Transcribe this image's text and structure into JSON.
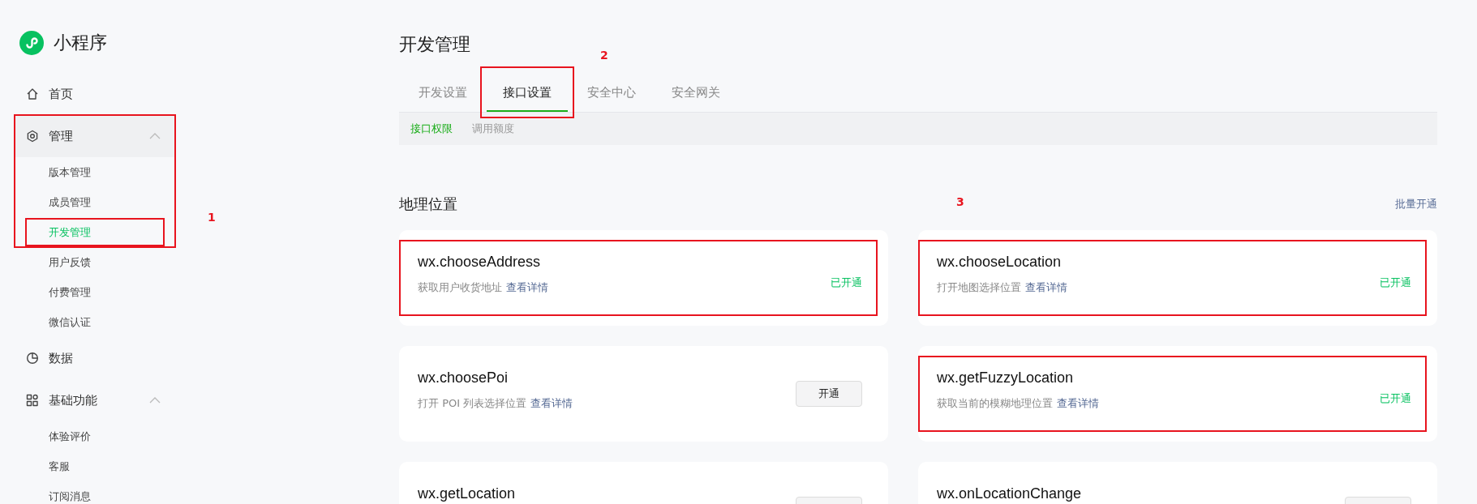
{
  "sidebar": {
    "logo": {
      "title": "小程序"
    },
    "items": [
      {
        "label": "首页"
      },
      {
        "label": "管理",
        "expanded": true,
        "marked": true,
        "marker": "1",
        "children": [
          {
            "label": "版本管理",
            "selected": false
          },
          {
            "label": "成员管理",
            "selected": false
          },
          {
            "label": "开发管理",
            "selected": true,
            "marked": true
          },
          {
            "label": "用户反馈",
            "selected": false
          },
          {
            "label": "付费管理",
            "selected": false
          },
          {
            "label": "微信认证",
            "selected": false
          }
        ]
      },
      {
        "label": "数据"
      },
      {
        "label": "基础功能",
        "expanded": true,
        "children": [
          {
            "label": "体验评价",
            "selected": false
          },
          {
            "label": "客服",
            "selected": false
          },
          {
            "label": "订阅消息",
            "selected": false
          }
        ]
      }
    ]
  },
  "page": {
    "title": "开发管理",
    "tabs": [
      {
        "label": "开发设置",
        "selected": false
      },
      {
        "label": "接口设置",
        "selected": true,
        "marked": true,
        "marker": "2"
      },
      {
        "label": "安全中心",
        "selected": false
      },
      {
        "label": "安全网关",
        "selected": false
      }
    ],
    "subtabs": [
      {
        "label": "接口权限",
        "selected": true
      },
      {
        "label": "调用额度",
        "selected": false
      }
    ]
  },
  "section": {
    "title": "地理位置",
    "marker": "3",
    "batch_action": "批量开通",
    "cards": [
      {
        "name": "wx.chooseAddress",
        "description": "获取用户收货地址",
        "link": "查看详情",
        "enabled": true,
        "status": "已开通",
        "marked": true
      },
      {
        "name": "wx.chooseLocation",
        "description": "打开地图选择位置",
        "link": "查看详情",
        "enabled": true,
        "status": "已开通",
        "marked": true
      },
      {
        "name": "wx.choosePoi",
        "description": "打开 POI 列表选择位置",
        "link": "查看详情",
        "enabled": false,
        "action": "开通"
      },
      {
        "name": "wx.getFuzzyLocation",
        "description": "获取当前的模糊地理位置",
        "link": "查看详情",
        "enabled": true,
        "status": "已开通",
        "marked": true
      },
      {
        "name": "wx.getLocation",
        "enabled": false
      },
      {
        "name": "wx.onLocationChange",
        "enabled": false
      }
    ]
  }
}
